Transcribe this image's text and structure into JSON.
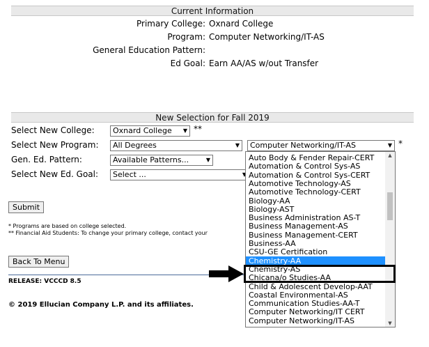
{
  "current": {
    "header": "Current Information",
    "rows": [
      {
        "label": "Primary College:",
        "value": "Oxnard College"
      },
      {
        "label": "Program:",
        "value": "Computer Networking/IT-AS"
      },
      {
        "label": "General Education Pattern:",
        "value": ""
      },
      {
        "label": "Ed Goal:",
        "value": "Earn AA/AS w/out Transfer"
      }
    ]
  },
  "new_selection": {
    "header": "New Selection for Fall 2019",
    "college_label": "Select New College:",
    "college_value": "Oxnard College",
    "college_required": "**",
    "program_label": "Select New Program:",
    "program_degrees": "All Degrees",
    "program_value": "Computer Networking/IT-AS",
    "program_required": "*",
    "gened_label": "Gen. Ed. Pattern:",
    "gened_value": "Available Patterns...",
    "goal_label": "Select New Ed. Goal:",
    "goal_value": "Select ..."
  },
  "submit_label": "Submit",
  "notes": {
    "note1": "* Programs are based on college selected.",
    "note2": "** Financial Aid Students: To change your primary college, contact your"
  },
  "back_label": "Back To Menu",
  "release": "RELEASE: VCCCD 8.5",
  "copyright": "© 2019 Ellucian Company L.P. and its affiliates.",
  "program_options": [
    "Auto Body & Fender Repair-CERT",
    "Automation & Control Sys-AS",
    "Automation & Control Sys-CERT",
    "Automotive Technology-AS",
    "Automotive Technology-CERT",
    "Biology-AA",
    "Biology-AST",
    "Business Administration AS-T",
    "Business Management-AS",
    "Business Management-CERT",
    "Business-AA",
    "CSU-GE Certification",
    "Chemistry-AA",
    "Chemistry-AS",
    "Chicana/o Studies-AA",
    "Child & Adolescent Develop-AAT",
    "Coastal Environmental-AS",
    "Communication Studies-AA-T",
    "Computer Networking/IT CERT",
    "Computer Networking/IT-AS"
  ],
  "highlighted_option_index": 12,
  "colors": {
    "highlight": "#1e90ff",
    "header_bg": "#e9e9e9",
    "annotation_arrow": "#000000"
  },
  "icons": {
    "select_arrow": "chevron-down-icon",
    "annotation": "arrow-right-icon"
  }
}
